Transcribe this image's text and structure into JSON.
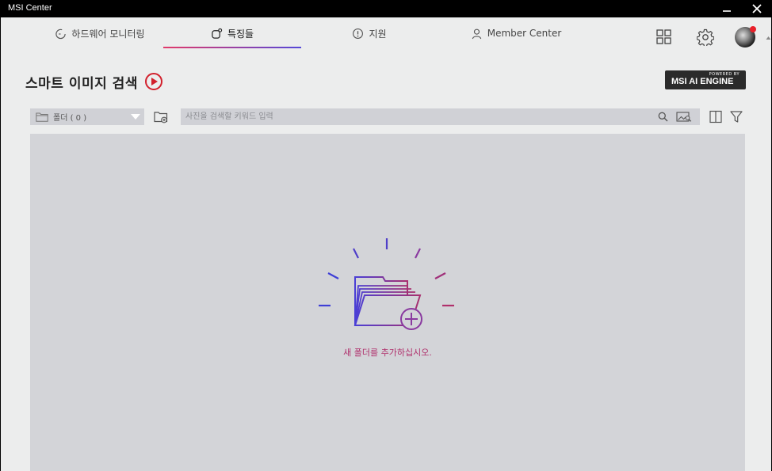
{
  "window": {
    "title": "MSI Center",
    "minimize_glyph": "—",
    "close_glyph": "✕"
  },
  "nav": {
    "tabs": [
      {
        "label": "하드웨어 모니터링",
        "icon": "gauge-icon"
      },
      {
        "label": "특징들",
        "icon": "features-icon",
        "active": true
      },
      {
        "label": "지원",
        "icon": "support-icon"
      },
      {
        "label": "Member Center",
        "icon": "user-icon"
      }
    ],
    "accent_gradient": [
      "#e23a6a",
      "#5548d8"
    ]
  },
  "page": {
    "title": "스마트 이미지 검색"
  },
  "ai_badge": {
    "powered": "POWERED BY",
    "engine": "MSI AI ENGINE"
  },
  "toolbar": {
    "folder_label": "폴더 ( 0 )",
    "search_placeholder": "사진을 검색할 키워드 입력"
  },
  "empty_state": {
    "message": "새 폴더를 추가하십시오."
  },
  "colors": {
    "accent_red": "#d2202c",
    "message": "#b0306c"
  }
}
